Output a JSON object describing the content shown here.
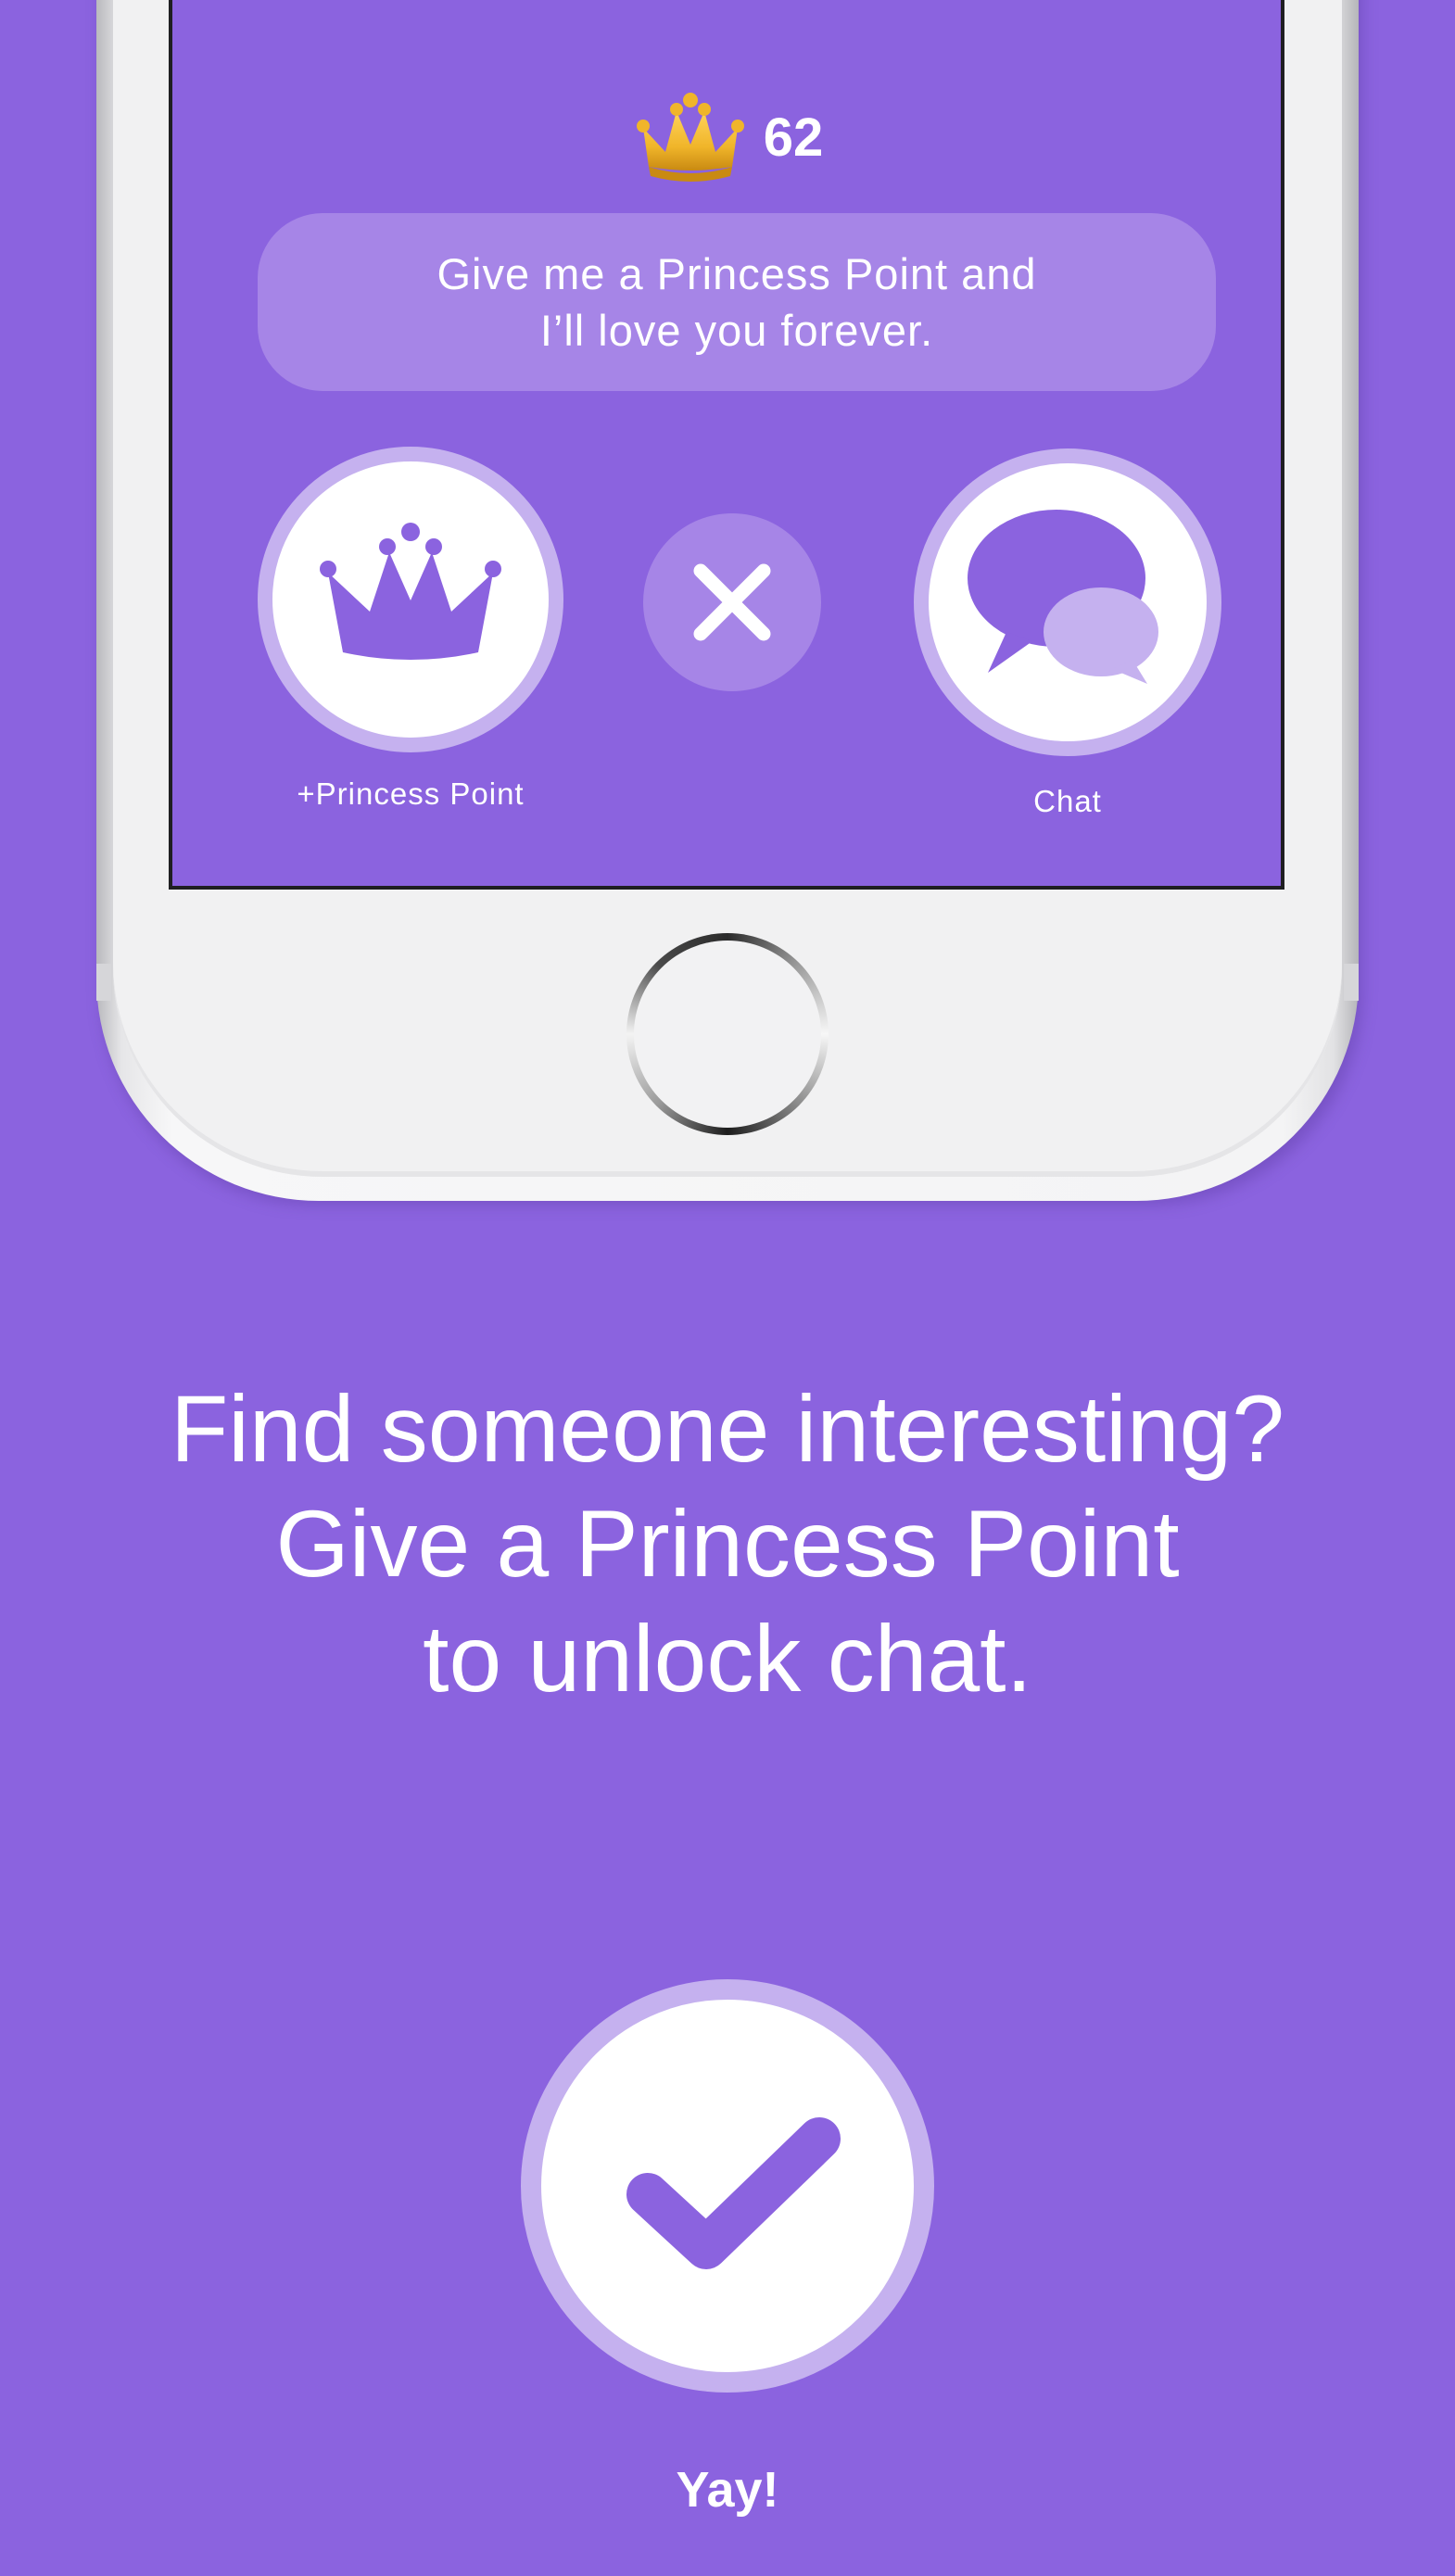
{
  "colors": {
    "background": "#8b63df",
    "accent": "#8b63df",
    "ring": "#c5b1ef",
    "bubble": "#a685e7",
    "gold": "#f0b52a",
    "white": "#ffffff"
  },
  "profile_card": {
    "score_icon": "gold-crown-icon",
    "score": "62",
    "message": "Give me a Princess Point and\nI’ll love you forever.",
    "actions": [
      {
        "id": "princess",
        "icon": "crown-icon",
        "label": "+Princess Point"
      },
      {
        "id": "dismiss",
        "icon": "close-icon",
        "label": ""
      },
      {
        "id": "chat",
        "icon": "chat-bubbles-icon",
        "label": "Chat"
      }
    ]
  },
  "headline": "Find someone interesting?\nGive a Princess Point\nto unlock chat.",
  "confirm": {
    "icon": "checkmark-icon",
    "label": "Yay!"
  }
}
